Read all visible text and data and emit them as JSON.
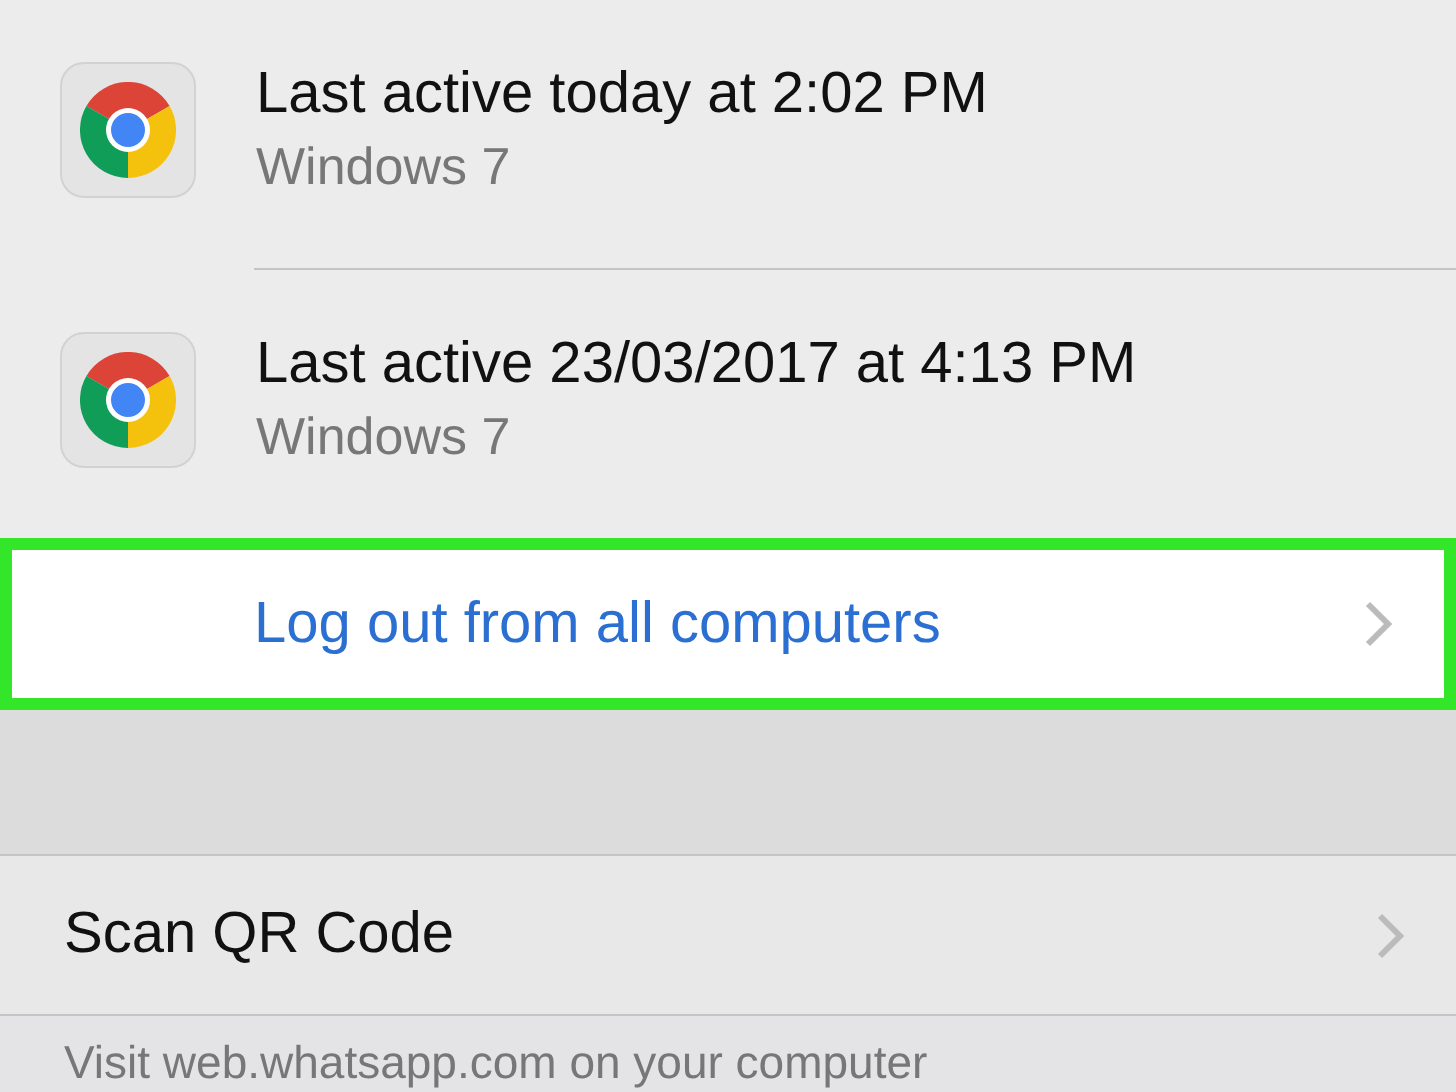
{
  "sessions": [
    {
      "title": "Last active today at 2:02 PM",
      "subtitle": "Windows 7"
    },
    {
      "title": "Last active 23/03/2017 at 4:13 PM",
      "subtitle": "Windows 7"
    }
  ],
  "logout_row": {
    "label": "Log out from all computers",
    "highlighted": true
  },
  "scan_row": {
    "label": "Scan QR Code"
  },
  "footer": "Visit web.whatsapp.com on your computer"
}
